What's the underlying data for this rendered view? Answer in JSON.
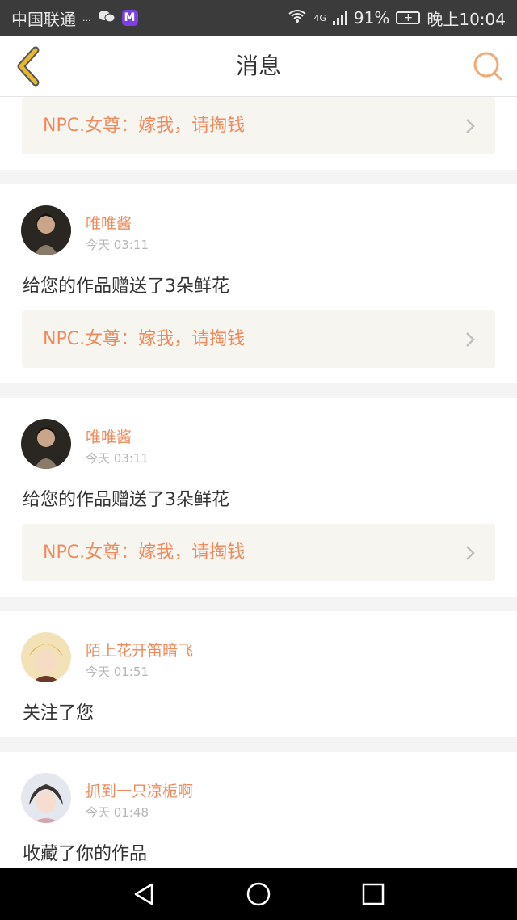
{
  "status_bar": {
    "carrier": "中国联通",
    "small_tag": "...",
    "app_badge": "M",
    "network": "4G",
    "battery": "91%",
    "time": "晚上10:04"
  },
  "nav": {
    "title": "消息"
  },
  "messages": [
    {
      "quote": "NPC.女尊：嫁我，请掏钱"
    },
    {
      "user": "唯唯酱",
      "time": "今天 03:11",
      "text": "给您的作品赠送了3朵鲜花",
      "quote": "NPC.女尊：嫁我，请掏钱"
    },
    {
      "user": "唯唯酱",
      "time": "今天 03:11",
      "text": "给您的作品赠送了3朵鲜花",
      "quote": "NPC.女尊：嫁我，请掏钱"
    },
    {
      "user": "陌上花开笛暗飞",
      "time": "今天 01:51",
      "text": "关注了您"
    },
    {
      "user": "抓到一只凉栀啊",
      "time": "今天 01:48",
      "text": "收藏了你的作品"
    }
  ],
  "colors": {
    "accent": "#ee8a5b",
    "back_arrow": "#e8b82e",
    "quote_bg": "#f6f5f0"
  },
  "icons": [
    "back-arrow-icon",
    "search-icon",
    "chevron-right-icon",
    "wifi-icon",
    "signal-icon",
    "battery-icon",
    "back-triangle-icon",
    "home-circle-icon",
    "recent-square-icon"
  ]
}
